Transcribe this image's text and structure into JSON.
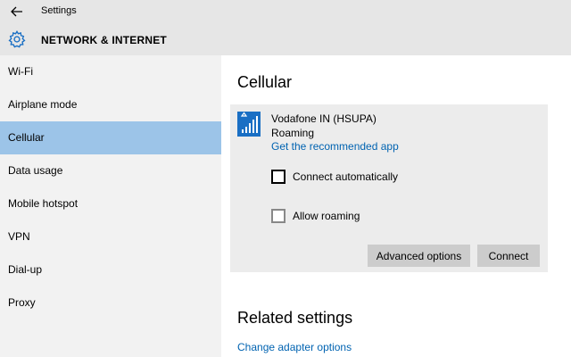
{
  "window": {
    "title": "Settings"
  },
  "header": {
    "title": "NETWORK & INTERNET"
  },
  "sidebar": {
    "items": [
      {
        "label": "Wi-Fi"
      },
      {
        "label": "Airplane mode"
      },
      {
        "label": "Cellular",
        "selected": true
      },
      {
        "label": "Data usage"
      },
      {
        "label": "Mobile hotspot"
      },
      {
        "label": "VPN"
      },
      {
        "label": "Dial-up"
      },
      {
        "label": "Proxy"
      }
    ]
  },
  "main": {
    "title": "Cellular",
    "network": {
      "name": "Vodafone IN (HSUPA)",
      "status": "Roaming",
      "link": "Get the recommended app",
      "connect_automatically": {
        "label": "Connect automatically",
        "checked": false
      },
      "allow_roaming": {
        "label": "Allow roaming",
        "checked": false
      },
      "advanced_label": "Advanced options",
      "connect_label": "Connect"
    },
    "related": {
      "title": "Related settings",
      "link": "Change adapter options"
    }
  },
  "colors": {
    "accent": "#0063b1",
    "selected_nav": "#9cc4e8",
    "tile": "#1a6fc4"
  },
  "icons": {
    "back": "back-arrow-icon",
    "settings": "gear-icon",
    "network": "cellular-signal-icon"
  }
}
